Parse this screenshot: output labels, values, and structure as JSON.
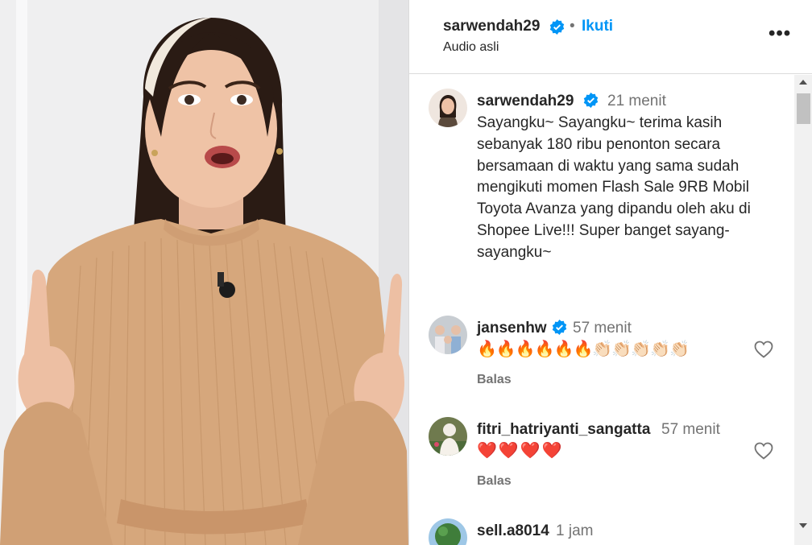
{
  "post": {
    "username": "sarwendah29",
    "separator": "•",
    "follow_label": "Ikuti",
    "audio_label": "Audio asli",
    "more_label": "•••",
    "verified_icon": "verified-badge-icon",
    "accent_color": "#0095f6"
  },
  "caption": {
    "username": "sarwendah29",
    "time": "21 menit",
    "text": "Sayangku~ Sayangku~ terima kasih sebanyak 180 ribu penonton secara bersamaan di waktu yang sama sudah mengikuti momen Flash Sale 9RB Mobil Toyota Avanza yang dipandu oleh aku di Shopee Live!!! Super banget sayang-sayangku~"
  },
  "comments": [
    {
      "username": "jansenhw",
      "verified": true,
      "time": "57 menit",
      "text": "🔥🔥🔥🔥🔥🔥👏🏻👏🏻👏🏻👏🏻👏🏻",
      "reply_label": "Balas"
    },
    {
      "username": "fitri_hatriyanti_sangatta",
      "verified": false,
      "time": "57 menit",
      "text": "❤️❤️❤️❤️",
      "reply_label": "Balas"
    },
    {
      "username": "sell.a8014",
      "verified": false,
      "time": "1 jam",
      "text": "",
      "reply_label": ""
    }
  ]
}
